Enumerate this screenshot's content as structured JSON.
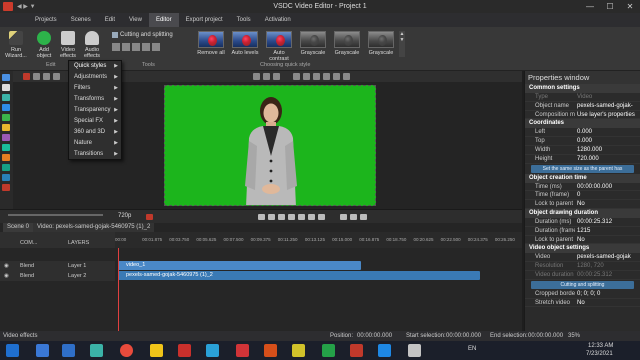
{
  "window": {
    "title": "VSDC Video Editor - Project 1",
    "minimize": "—",
    "maximize": "☐",
    "close": "✕",
    "quick_access": "◀ ▶ ▼"
  },
  "menu": [
    "Projects",
    "Scenes",
    "Edit",
    "View",
    "Editor",
    "Export project",
    "Tools",
    "Activation"
  ],
  "menu_active": "Editor",
  "ribbon": {
    "run_wizard": "Run\nWizard...",
    "add_object": "Add\nobject",
    "video_effects": "Video\neffects",
    "audio_effects": "Audio\neffects",
    "cutting_splitting": "Cutting and splitting",
    "group_edit": "Edit",
    "group_tools": "Tools",
    "group_quick_style": "Choosing quick style",
    "quick_styles": [
      {
        "label": "Remove all",
        "gray": false
      },
      {
        "label": "Auto levels",
        "gray": false
      },
      {
        "label": "Auto contrast",
        "gray": false
      },
      {
        "label": "Grayscale",
        "gray": true
      },
      {
        "label": "Grayscale",
        "gray": true
      },
      {
        "label": "Grayscale",
        "gray": true
      }
    ]
  },
  "video_effects_menu": [
    "Quick styles",
    "Adjustments",
    "Filters",
    "Transforms",
    "Transparency",
    "Special FX",
    "360 and 3D",
    "Nature",
    "Transitions"
  ],
  "properties": {
    "title": "Properties window",
    "common_settings": "Common settings",
    "type_label": "Type",
    "type_value": "Video",
    "object_name_label": "Object name",
    "object_name_value": "pexels-samed-gojak-",
    "composition_label": "Composition mod",
    "composition_value": "Use layer's properties",
    "coordinates": "Coordinates",
    "left_label": "Left",
    "left_value": "0.000",
    "top_label": "Top",
    "top_value": "0.000",
    "width_label": "Width",
    "width_value": "1280.000",
    "height_label": "Height",
    "height_value": "720.000",
    "same_size_btn": "Set the same size as the parent has",
    "creation_time": "Object creation time",
    "time_ms_label": "Time (ms)",
    "time_ms_value": "00:00:00.000",
    "time_frame_label": "Time (frame)",
    "time_frame_value": "0",
    "lock_parent_label": "Lock to parent",
    "lock_parent_value": "No",
    "drawing_duration": "Object drawing duration",
    "duration_ms_label": "Duration (ms)",
    "duration_ms_value": "00:00:25.312",
    "duration_frames_label": "Duration (frame",
    "duration_frames_value": "1215",
    "lock_parent2_label": "Lock to parent",
    "lock_parent2_value": "No",
    "video_object_settings": "Video object settings",
    "video_label": "Video",
    "video_value": "pexels-samed-gojak",
    "resolution_label": "Resolution",
    "resolution_value": "1280, 720",
    "video_duration_label": "Video duration",
    "video_duration_value": "00:00:25.312",
    "cutting_btn": "Cutting and splitting",
    "cropped_label": "Cropped borders",
    "cropped_value": "0; 0; 0; 0",
    "stretch_label": "Stretch video",
    "stretch_value": "No"
  },
  "playback": {
    "zoom": "720p"
  },
  "timeline": {
    "tab1": "Scene 0",
    "tab2": "Video: pexels-samed-gojak-5460975 (1)_2",
    "layers_label": "LAYERS",
    "com_label": "COM...",
    "ruler_ticks": [
      "00:00",
      "00:01.875",
      "00:03.750",
      "00:05.625",
      "00:07.500",
      "00:09.375",
      "00:11.250",
      "00:13.125",
      "00:15.000",
      "00:16.875",
      "00:18.750",
      "00:20.625",
      "00:22.500",
      "00:24.375",
      "00:26.250"
    ],
    "row1": {
      "blend": "Blend",
      "name": "Layer 1",
      "clip": "video_1"
    },
    "row2": {
      "blend": "Blend",
      "name": "Layer 2",
      "clip": "pexels-samed-gojak-5460975 (1)_2"
    }
  },
  "status": {
    "left": "Video effects",
    "position_label": "Position:",
    "position_value": "00:00:00.000",
    "start_label": "Start selection:",
    "start_value": "00:00:00.000",
    "end_label": "End selection:",
    "end_value": "00:00:00.000",
    "zoom": "35%"
  },
  "taskbar": {
    "lang": "EN",
    "time": "12:33 AM",
    "date": "7/23/2021"
  }
}
